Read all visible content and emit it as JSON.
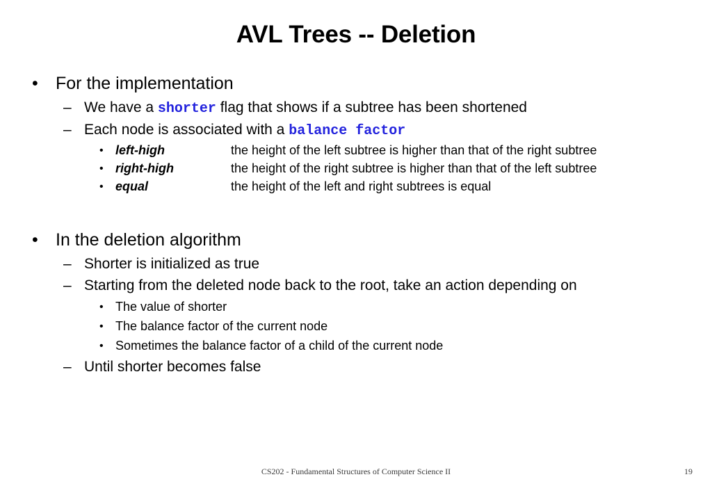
{
  "slide": {
    "title": "AVL Trees -- Deletion",
    "accent_color": "#2222dd",
    "text_color": "#000000",
    "background_color": "#ffffff"
  },
  "markers": {
    "bullet": "•",
    "dash": "–"
  },
  "sections": [
    {
      "heading": "For the implementation",
      "sub_bullets": [
        {
          "prefix": "We have a ",
          "code": "shorter",
          "suffix": " flag that shows if a subtree has been shortened"
        },
        {
          "prefix": "Each node is associated with a ",
          "code": "balance factor",
          "suffix": ""
        }
      ],
      "definitions": [
        {
          "term": "left-high",
          "description": "the height of the left subtree is higher than that of the right subtree"
        },
        {
          "term": "right-high",
          "description": "the height of the right subtree is higher than that of the left subtree"
        },
        {
          "term": "equal",
          "description": "the height of the left and right subtrees is equal"
        }
      ]
    },
    {
      "heading": "In the deletion algorithm",
      "sub_bullets": [
        {
          "text": "Shorter is initialized as true"
        },
        {
          "text": "Starting from the deleted node back to the root, take an action depending on"
        }
      ],
      "third_level": [
        "The value of shorter",
        "The balance factor of the current node",
        "Sometimes the balance factor of a child of the current node"
      ],
      "closing_bullet": "Until shorter becomes false"
    }
  ],
  "footer": {
    "course": "CS202 - Fundamental Structures of Computer Science II",
    "page_number": "19"
  }
}
